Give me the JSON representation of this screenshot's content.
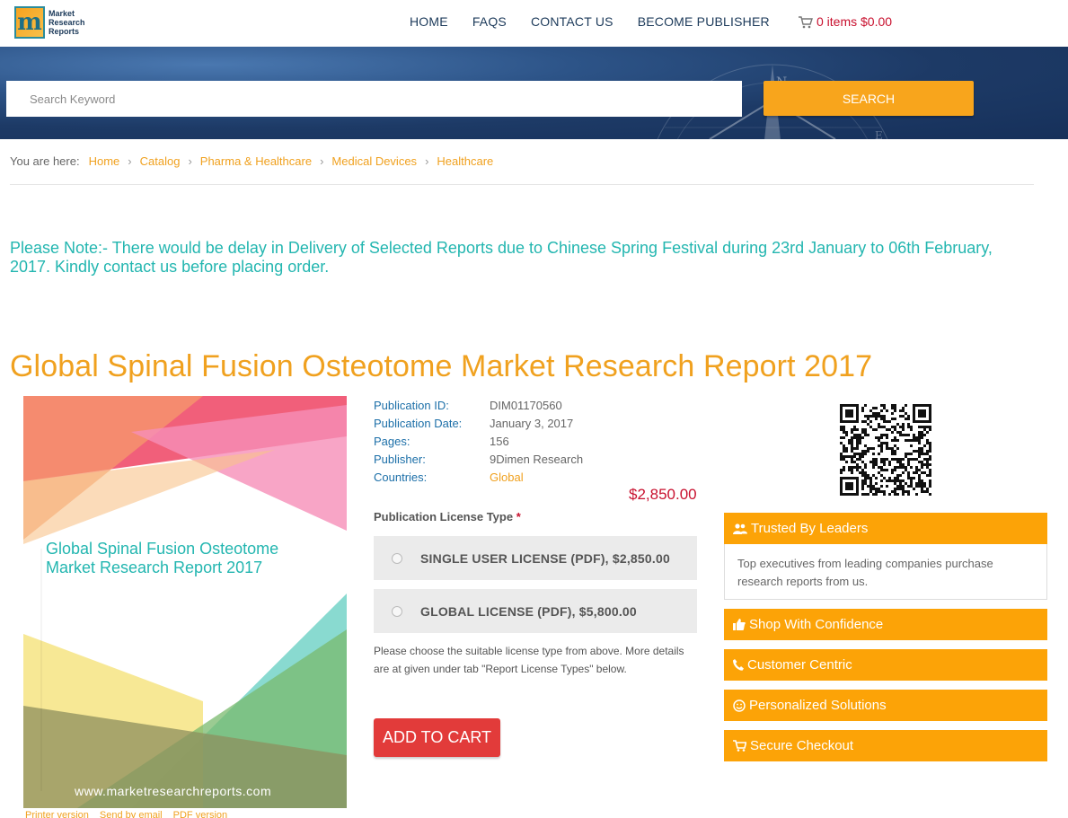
{
  "header": {
    "logo_text": [
      "Market",
      "Research",
      "Reports"
    ],
    "nav": [
      "HOME",
      "FAQS",
      "CONTACT US",
      "BECOME PUBLISHER"
    ],
    "cart_label": "0 items $0.00"
  },
  "search": {
    "placeholder": "Search Keyword",
    "button_label": "SEARCH"
  },
  "breadcrumb": {
    "prefix": "You are here:",
    "items": [
      "Home",
      "Catalog",
      "Pharma & Healthcare",
      "Medical Devices",
      "Healthcare"
    ]
  },
  "notice": "Please Note:- There would be delay in Delivery of Selected Reports due to Chinese Spring Festival during 23rd January to 06th February, 2017. Kindly contact us before placing order.",
  "report": {
    "title": "Global Spinal Fusion Osteotome Market Research Report 2017",
    "cover_title": "Global Spinal Fusion Osteotome Market Research Report 2017",
    "cover_site": "www.marketresearchreports.com",
    "meta": [
      {
        "label": "Publication ID:",
        "value": "DIM01170560"
      },
      {
        "label": "Publication Date:",
        "value": "January 3, 2017"
      },
      {
        "label": "Pages:",
        "value": "156"
      },
      {
        "label": "Publisher:",
        "value": "9Dimen Research"
      },
      {
        "label": "Countries:",
        "value": "Global"
      }
    ],
    "price": "$2,850.00",
    "license_label": "Publication License Type",
    "license_required": "*",
    "licenses": [
      "SINGLE USER LICENSE (PDF), $2,850.00",
      "GLOBAL LICENSE (PDF), $5,800.00"
    ],
    "license_note": "Please choose the suitable license type from above. More details are at given under tab \"Report License Types\" below.",
    "add_to_cart": "ADD TO CART",
    "bottom_links": [
      "Printer version",
      "Send by email",
      "PDF version"
    ]
  },
  "sidebar": {
    "trusted": {
      "title": "Trusted By Leaders",
      "body": "Top executives from leading companies purchase research reports from us.",
      "icon": "users-icon"
    },
    "items": [
      {
        "label": "Shop With Confidence",
        "icon": "thumbs-up-icon"
      },
      {
        "label": "Customer Centric",
        "icon": "phone-icon"
      },
      {
        "label": "Personalized Solutions",
        "icon": "smile-icon"
      },
      {
        "label": "Secure Checkout",
        "icon": "cart-icon"
      }
    ]
  },
  "colors": {
    "accent": "#f8a51c",
    "teal": "#23b6b0",
    "price": "#c8102e",
    "label_blue": "#1c6fa8"
  }
}
